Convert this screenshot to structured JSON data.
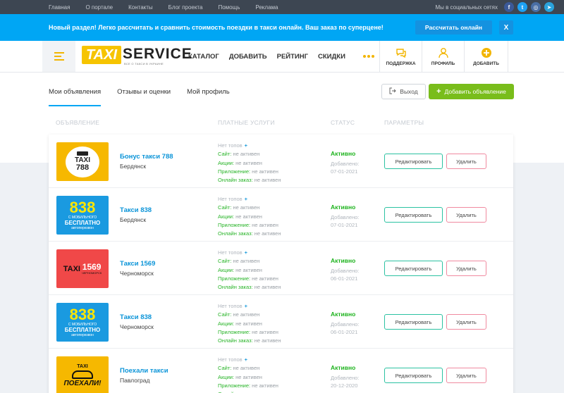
{
  "topnav": [
    "Главная",
    "О портале",
    "Контакты",
    "Блог проекта",
    "Помощь",
    "Реклама"
  ],
  "social": {
    "label": "Мы в социальных сетях",
    "icons": [
      {
        "name": "facebook-icon",
        "glyph": "f",
        "color": "#3b5998"
      },
      {
        "name": "twitter-icon",
        "glyph": "t",
        "color": "#1da1f2"
      },
      {
        "name": "instagram-icon",
        "glyph": "◎",
        "color": "#4a6fa5"
      },
      {
        "name": "telegram-icon",
        "glyph": "➤",
        "color": "#2aa3dc"
      }
    ]
  },
  "banner": {
    "text": "Новый раздел! Легко рассчитать и сравнить стоимость поездки в такси онлайн. Ваш заказ по суперцене!",
    "button": "Рассчитать онлайн",
    "close": "X"
  },
  "logo": {
    "taxi": "TAXI",
    "service": "SERVICE",
    "tagline": "ВСЕ О ТАКСИ В УКРАИНЕ"
  },
  "mainnav": [
    "КАТАЛОГ",
    "ДОБАВИТЬ",
    "РЕЙТИНГ",
    "СКИДКИ"
  ],
  "header_items": [
    {
      "name": "support",
      "label": "ПОДДЕРЖКА",
      "icon": "chat-icon"
    },
    {
      "name": "profile",
      "label": "ПРОФИЛЬ",
      "icon": "user-icon"
    },
    {
      "name": "add",
      "label": "ДОБАВИТЬ",
      "icon": "plus-circle-icon"
    }
  ],
  "tabs": [
    "Мои объявления",
    "Отзывы и оценки",
    "Мой профиль"
  ],
  "actions": {
    "exit": "Выход",
    "add": "Добавить объявление"
  },
  "columns": {
    "listing": "ОБЪЯВЛЕНИЕ",
    "paid": "ПЛАТНЫЕ УСЛУГИ",
    "status": "СТАТУС",
    "params": "ПАРАМЕТРЫ"
  },
  "labels": {
    "no_top": "Нет топов",
    "site": "Сайт:",
    "promo": "Акции:",
    "app": "Приложение:",
    "online": "Онлайн заказ:",
    "inactive": "не активен",
    "added": "Добавлено:",
    "edit": "Редактировать",
    "delete": "Удалить"
  },
  "colors": {
    "accent": "#00a6f4",
    "green": "#79bd1b",
    "yellow": "#f6c400"
  },
  "listings": [
    {
      "name": "Бонус такси 788",
      "city": "Бердянск",
      "status": "Активно",
      "date": "07-01-2021",
      "thumb": {
        "type": "bonus",
        "line1": "TAXI",
        "line2": "788"
      }
    },
    {
      "name": "Такси 838",
      "city": "Бердянск",
      "status": "Активно",
      "date": "07-01-2021",
      "thumb": {
        "type": "838",
        "line1": "838",
        "line2": "С МОБИЛЬНОГО",
        "line3": "БЕСПЛАТНО",
        "line4": "автоперезвон"
      }
    },
    {
      "name": "Такси 1569",
      "city": "Черноморск",
      "status": "Активно",
      "date": "06-01-2021",
      "thumb": {
        "type": "1569",
        "line1": "TAXI",
        "line2": "1569",
        "line3": "ЧЕРНОМОРСК"
      }
    },
    {
      "name": "Такси 838",
      "city": "Черноморск",
      "status": "Активно",
      "date": "06-01-2021",
      "thumb": {
        "type": "838",
        "line1": "838",
        "line2": "С МОБИЛЬНОГО",
        "line3": "БЕСПЛАТНО",
        "line4": "автоперезвон"
      }
    },
    {
      "name": "Поехали такси",
      "city": "Павлоград",
      "status": "Активно",
      "date": "20-12-2020",
      "thumb": {
        "type": "poehali",
        "line1": "TAXI",
        "line2": "ПОЕХАЛИ!"
      }
    }
  ]
}
